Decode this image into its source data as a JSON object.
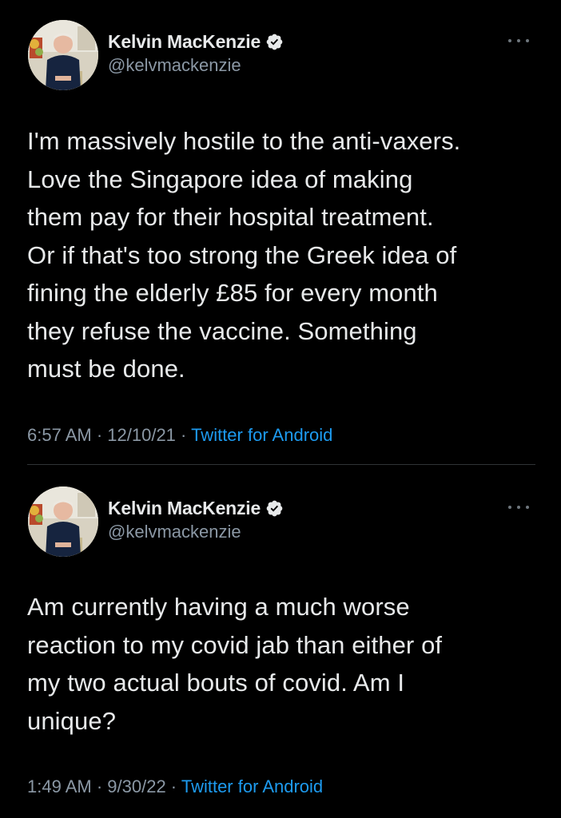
{
  "tweets": [
    {
      "author": {
        "name": "Kelvin MacKenzie",
        "handle": "@kelvmackenzie",
        "verified_icon": "verified-badge-icon"
      },
      "text": "I'm massively hostile to the anti-vaxers.\nLove the Singapore idea of making\nthem pay for their hospital treatment.\nOr if that's too strong the Greek idea of\nfining the elderly £85 for every month\nthey refuse the vaccine. Something\nmust be done.",
      "time": "6:57 AM",
      "date": "12/10/21",
      "separator": " · ",
      "source": "Twitter for Android"
    },
    {
      "author": {
        "name": "Kelvin MacKenzie",
        "handle": "@kelvmackenzie",
        "verified_icon": "verified-badge-icon"
      },
      "text": "Am currently having a much worse\nreaction to my covid jab than either of\nmy two actual bouts of covid. Am I\nunique?",
      "time": "1:49 AM",
      "date": "9/30/22",
      "separator": " · ",
      "source": "Twitter for Android"
    }
  ],
  "colors": {
    "background": "#000000",
    "text": "#e7e9ea",
    "secondary": "#8b98a5",
    "link": "#1d9bf0",
    "divider": "#2f3336"
  }
}
